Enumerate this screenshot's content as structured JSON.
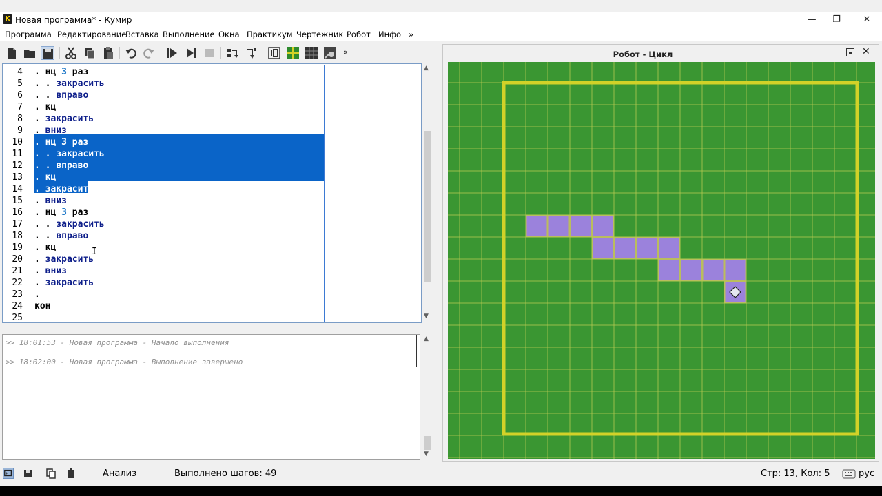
{
  "window": {
    "title": "Новая программа* - Кумир",
    "app_icon_letter": "K",
    "minimize": "—",
    "restore": "❐",
    "close": "✕"
  },
  "menu": [
    "Программа",
    "Редактирование",
    "Вставка",
    "Выполнение",
    "Окна",
    "Практикум",
    "Чертежник",
    "Робот",
    "Инфо",
    "»"
  ],
  "toolbar": {
    "overflow": "»",
    "icons": [
      "new-file-icon",
      "open-folder-icon",
      "save-icon",
      "cut-icon",
      "copy-icon",
      "paste-icon",
      "undo-icon",
      "redo-icon",
      "run-icon",
      "step-run-icon",
      "stop-icon",
      "step-over-icon",
      "step-into-icon",
      "counter-icon",
      "robot-field-icon",
      "grid-icon",
      "draw-icon"
    ]
  },
  "editor": {
    "lines": [
      {
        "n": "4",
        "tokens": [
          {
            "t": ". ",
            "c": "kw"
          },
          {
            "t": "нц ",
            "c": "kw"
          },
          {
            "t": "3",
            "c": "num"
          },
          {
            "t": " раз",
            "c": "kw"
          }
        ]
      },
      {
        "n": "5",
        "tokens": [
          {
            "t": ". . ",
            "c": "kw"
          },
          {
            "t": "закрасить",
            "c": "cmd"
          }
        ]
      },
      {
        "n": "6",
        "tokens": [
          {
            "t": ". . ",
            "c": "kw"
          },
          {
            "t": "вправо",
            "c": "cmd"
          }
        ]
      },
      {
        "n": "7",
        "tokens": [
          {
            "t": ". ",
            "c": "kw"
          },
          {
            "t": "кц",
            "c": "kw"
          }
        ]
      },
      {
        "n": "8",
        "tokens": [
          {
            "t": ". ",
            "c": "kw"
          },
          {
            "t": "закрасить",
            "c": "cmd"
          }
        ]
      },
      {
        "n": "9",
        "tokens": [
          {
            "t": ". ",
            "c": "kw"
          },
          {
            "t": "вниз",
            "c": "cmd"
          }
        ]
      },
      {
        "n": "10",
        "tokens": [
          {
            "t": ". ",
            "c": "kw"
          },
          {
            "t": "нц ",
            "c": "kw"
          },
          {
            "t": "3",
            "c": "num"
          },
          {
            "t": " раз",
            "c": "kw"
          }
        ],
        "sel": true
      },
      {
        "n": "11",
        "tokens": [
          {
            "t": ". . ",
            "c": "kw"
          },
          {
            "t": "закрасить",
            "c": "cmd"
          }
        ],
        "sel": true
      },
      {
        "n": "12",
        "tokens": [
          {
            "t": ". . ",
            "c": "kw"
          },
          {
            "t": "вправо",
            "c": "cmd"
          }
        ],
        "sel": true
      },
      {
        "n": "13",
        "tokens": [
          {
            "t": ". ",
            "c": "kw"
          },
          {
            "t": "кц",
            "c": "kw"
          }
        ],
        "sel": true
      },
      {
        "n": "14",
        "tokens": [
          {
            "t": ". ",
            "c": "kw"
          },
          {
            "t": "закрасить",
            "c": "cmd"
          }
        ],
        "partial": true
      },
      {
        "n": "15",
        "tokens": [
          {
            "t": ". ",
            "c": "kw"
          },
          {
            "t": "вниз",
            "c": "cmd"
          }
        ]
      },
      {
        "n": "16",
        "tokens": [
          {
            "t": ". ",
            "c": "kw"
          },
          {
            "t": "нц ",
            "c": "kw"
          },
          {
            "t": "3",
            "c": "num"
          },
          {
            "t": " раз",
            "c": "kw"
          }
        ]
      },
      {
        "n": "17",
        "tokens": [
          {
            "t": ". . ",
            "c": "kw"
          },
          {
            "t": "закрасить",
            "c": "cmd"
          }
        ]
      },
      {
        "n": "18",
        "tokens": [
          {
            "t": ". . ",
            "c": "kw"
          },
          {
            "t": "вправо",
            "c": "cmd"
          }
        ]
      },
      {
        "n": "19",
        "tokens": [
          {
            "t": ". ",
            "c": "kw"
          },
          {
            "t": "кц",
            "c": "kw"
          }
        ]
      },
      {
        "n": "20",
        "tokens": [
          {
            "t": ". ",
            "c": "kw"
          },
          {
            "t": "закрасить",
            "c": "cmd"
          }
        ]
      },
      {
        "n": "21",
        "tokens": [
          {
            "t": ". ",
            "c": "kw"
          },
          {
            "t": "вниз",
            "c": "cmd"
          }
        ]
      },
      {
        "n": "22",
        "tokens": [
          {
            "t": ". ",
            "c": "kw"
          },
          {
            "t": "закрасить",
            "c": "cmd"
          }
        ]
      },
      {
        "n": "23",
        "tokens": [
          {
            "t": ".",
            "c": "kw"
          }
        ]
      },
      {
        "n": "24",
        "tokens": [
          {
            "t": "кон",
            "c": "kw"
          }
        ],
        "noindent": true
      },
      {
        "n": "25",
        "tokens": []
      }
    ],
    "cursor": "I"
  },
  "log": {
    "lines": [
      ">> 18:01:53 - Новая программа - Начало выполнения",
      ">> 18:02:00 - Новая программа - Выполнение завершено"
    ]
  },
  "robot": {
    "title": "Робот - Цикл",
    "colors": {
      "field": "#3a9632",
      "grid": "#b4c850",
      "wall": "#d2d228",
      "painted": "#9b82dc",
      "robot": "#e6e6f0"
    },
    "cols": 19,
    "rows": 18,
    "wall_box": {
      "col0": 1,
      "row0": 1,
      "col1": 18,
      "row1": 17
    },
    "painted_cells": [
      [
        3,
        7
      ],
      [
        4,
        7
      ],
      [
        5,
        7
      ],
      [
        6,
        7
      ],
      [
        6,
        8
      ],
      [
        7,
        8
      ],
      [
        8,
        8
      ],
      [
        9,
        8
      ],
      [
        9,
        9
      ],
      [
        10,
        9
      ],
      [
        11,
        9
      ],
      [
        12,
        9
      ],
      [
        12,
        10
      ]
    ],
    "robot_cell": [
      12,
      10
    ]
  },
  "status": {
    "mode": "Анализ",
    "steps": "Выполнено шагов: 49",
    "position": "Стр: 13, Кол: 5",
    "lang": "рус",
    "icons": [
      "console-icon",
      "save-log-icon",
      "copy-log-icon",
      "clear-log-icon",
      "keyboard-icon"
    ]
  }
}
